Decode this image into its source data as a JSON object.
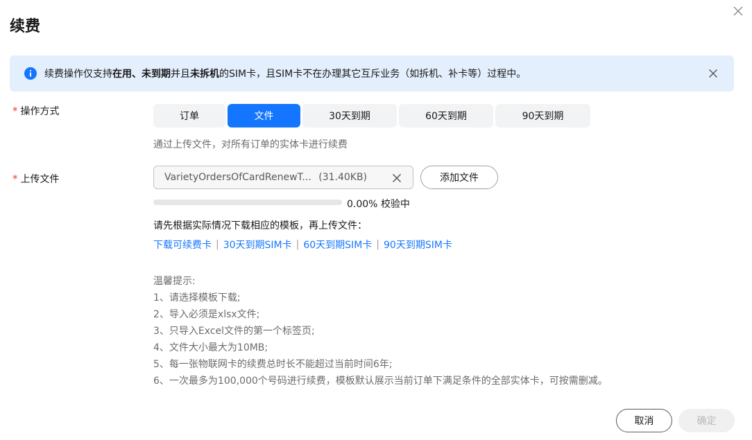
{
  "dialog": {
    "title": "续费"
  },
  "alert": {
    "parts": [
      "续费操作仅支持",
      "在用、未到期",
      "并且",
      "未拆机",
      "的SIM卡，且SIM卡不在办理其它互斥业务（如拆机、补卡等）过程中。"
    ],
    "accent": "#1476ff",
    "background": "#e3effd"
  },
  "operation": {
    "required_mark": "*",
    "label": "操作方式",
    "options": [
      "订单",
      "文件",
      "30天到期",
      "60天到期",
      "90天到期"
    ],
    "selected": "文件",
    "hint": "通过上传文件，对所有订单的实体卡进行续费"
  },
  "upload": {
    "required_mark": "*",
    "label": "上传文件",
    "file_name": "VarietyOrdersOfCardRenewT...",
    "file_size": "(31.40KB)",
    "add_button": "添加文件",
    "progress": 0,
    "progress_text": "0.00%",
    "status": "校验中",
    "instruction": "请先根据实际情况下载相应的模板，再上传文件：",
    "templates": [
      "下载可续费卡",
      "30天到期SIM卡",
      "60天到期SIM卡",
      "90天到期SIM卡"
    ],
    "separator": "|"
  },
  "tips": {
    "title": "温馨提示:",
    "items": [
      "1、请选择模板下载;",
      "2、导入必须是xlsx文件;",
      "3、只导入Excel文件的第一个标签页;",
      "4、文件大小最大为10MB;",
      "5、每一张物联网卡的续费总时长不能超过当前时间6年;",
      "6、一次最多为100,000个号码进行续费，模板默认展示当前订单下满足条件的全部实体卡，可按需删减。"
    ]
  },
  "footer": {
    "cancel": "取消",
    "confirm": "确定"
  },
  "icons": {
    "close": "close-icon",
    "info": "info-icon",
    "remove": "close-icon"
  }
}
